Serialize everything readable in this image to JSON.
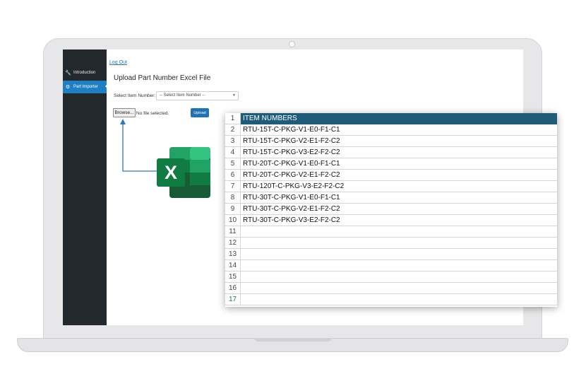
{
  "sidebar": {
    "items": [
      {
        "label": "Introduction",
        "icon": "wrench-icon"
      },
      {
        "label": "Part Importer",
        "icon": "gear-icon"
      }
    ]
  },
  "main": {
    "logout_label": "Log Out",
    "page_title": "Upload Part Number Excel File",
    "select_label": "Select Item Number:",
    "select_value": "-- Select Item Number --",
    "browse_label": "Browse...",
    "file_status": "No file selected.",
    "upload_label": "Upload"
  },
  "spreadsheet": {
    "rows": [
      {
        "num": "1",
        "value": "ITEM NUMBERS"
      },
      {
        "num": "2",
        "value": "RTU-15T-C-PKG-V1-E0-F1-C1"
      },
      {
        "num": "3",
        "value": "RTU-15T-C-PKG-V2-E1-F2-C2"
      },
      {
        "num": "4",
        "value": "RTU-15T-C-PKG-V3-E2-F2-C2"
      },
      {
        "num": "5",
        "value": "RTU-20T-C-PKG-V1-E0-F1-C1"
      },
      {
        "num": "6",
        "value": "RTU-20T-C-PKG-V2-E1-F2-C2"
      },
      {
        "num": "7",
        "value": "RTU-120T-C-PKG-V3-E2-F2-C2"
      },
      {
        "num": "8",
        "value": "RTU-30T-C-PKG-V1-E0-F1-C1"
      },
      {
        "num": "9",
        "value": "RTU-30T-C-PKG-V2-E1-F2-C2"
      },
      {
        "num": "10",
        "value": "RTU-30T-C-PKG-V3-E2-F2-C2"
      },
      {
        "num": "11",
        "value": ""
      },
      {
        "num": "12",
        "value": ""
      },
      {
        "num": "13",
        "value": ""
      },
      {
        "num": "14",
        "value": ""
      },
      {
        "num": "15",
        "value": ""
      },
      {
        "num": "16",
        "value": ""
      },
      {
        "num": "17",
        "value": ""
      }
    ]
  },
  "colors": {
    "sidebar_bg": "#23282d",
    "accent": "#1e7fc2",
    "sheet_header": "#1f5c7a",
    "excel_green": "#217346"
  }
}
